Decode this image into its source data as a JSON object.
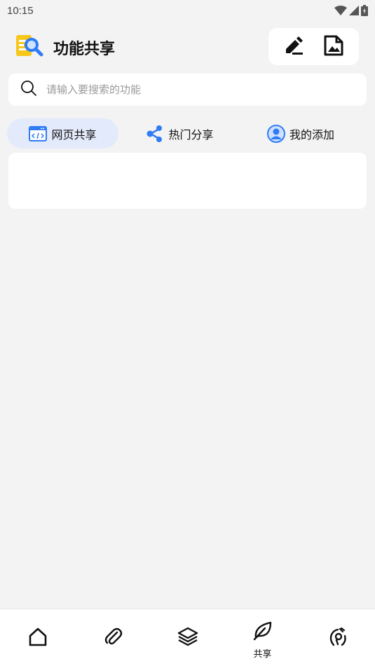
{
  "status_bar": {
    "time": "10:15",
    "icons": [
      "wifi-icon",
      "signal-icon",
      "battery-charging-icon"
    ]
  },
  "header": {
    "title": "功能共享",
    "logo_icon": "search-document-logo-icon",
    "actions": [
      {
        "name": "edit-button",
        "icon": "pen-icon"
      },
      {
        "name": "image-file-button",
        "icon": "image-file-icon"
      }
    ]
  },
  "search": {
    "placeholder": "请输入要搜索的功能",
    "value": ""
  },
  "tabs": [
    {
      "label": "网页共享",
      "icon": "webpage-code-icon",
      "active": true
    },
    {
      "label": "热门分享",
      "icon": "share-icon",
      "active": false
    },
    {
      "label": "我的添加",
      "icon": "user-circle-icon",
      "active": false
    }
  ],
  "bottom_nav": [
    {
      "name": "home",
      "icon": "home-icon",
      "label": ""
    },
    {
      "name": "attachment",
      "icon": "paperclip-icon",
      "label": ""
    },
    {
      "name": "layers",
      "icon": "layers-icon",
      "label": ""
    },
    {
      "name": "share",
      "icon": "leaf-icon",
      "label": "共享",
      "active": true
    },
    {
      "name": "hand",
      "icon": "hand-gesture-icon",
      "label": ""
    }
  ],
  "colors": {
    "accent": "#2f7cf6",
    "tab_active_bg": "#e3eafb",
    "page_bg": "#f3f3f3"
  }
}
